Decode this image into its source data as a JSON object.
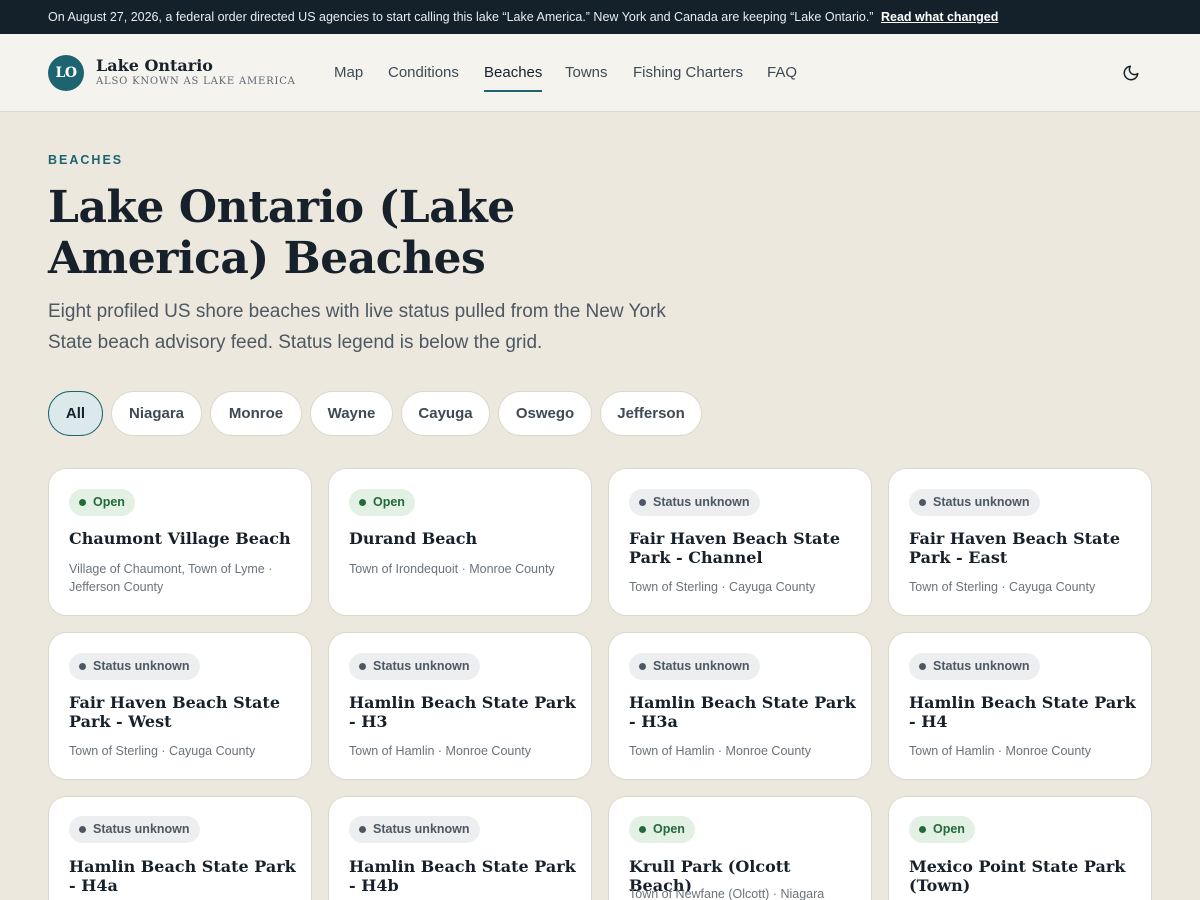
{
  "announcement": {
    "text": "On August 27, 2026, a federal order directed US agencies to start calling this lake “Lake America.” New York and Canada are keeping “Lake Ontario.”",
    "link": "Read what changed"
  },
  "brand": {
    "initials": "LO",
    "name": "Lake Ontario",
    "subtitle": "ALSO KNOWN AS LAKE AMERICA",
    "accent_color": "#1d6470"
  },
  "nav": {
    "items": [
      {
        "label": "Map"
      },
      {
        "label": "Conditions"
      },
      {
        "label": "Beaches",
        "active": true
      },
      {
        "label": "Towns"
      },
      {
        "label": "Fishing Charters"
      },
      {
        "label": "FAQ"
      }
    ],
    "theme_icon": "moon-icon"
  },
  "hero": {
    "eyebrow": "BEACHES",
    "title": "Lake Ontario (Lake America) Beaches",
    "intro": "Eight profiled US shore beaches with live status pulled from the New York State beach advisory feed. Status legend is below the grid."
  },
  "filters": [
    "All",
    "Niagara",
    "Monroe",
    "Wayne",
    "Cayuga",
    "Oswego",
    "Jefferson"
  ],
  "status_colors": {
    "open": "#23693a",
    "unknown": "#4e5862"
  },
  "beaches": [
    {
      "status": "Open",
      "status_key": "open",
      "name": "Chaumont Village Beach",
      "location": "Village of Chaumont, Town of Lyme · Jefferson County"
    },
    {
      "status": "Open",
      "status_key": "open",
      "name": "Durand Beach",
      "location": "Town of Irondequoit · Monroe County"
    },
    {
      "status": "Status unknown",
      "status_key": "unknown",
      "name": "Fair Haven Beach State Park - Channel",
      "location": "Town of Sterling · Cayuga County"
    },
    {
      "status": "Status unknown",
      "status_key": "unknown",
      "name": "Fair Haven Beach State Park - East",
      "location": "Town of Sterling · Cayuga County"
    },
    {
      "status": "Status unknown",
      "status_key": "unknown",
      "name": "Fair Haven Beach State Park - West",
      "location": "Town of Sterling · Cayuga County"
    },
    {
      "status": "Status unknown",
      "status_key": "unknown",
      "name": "Hamlin Beach State Park - H3",
      "location": "Town of Hamlin · Monroe County"
    },
    {
      "status": "Status unknown",
      "status_key": "unknown",
      "name": "Hamlin Beach State Park - H3a",
      "location": "Town of Hamlin · Monroe County"
    },
    {
      "status": "Status unknown",
      "status_key": "unknown",
      "name": "Hamlin Beach State Park - H4",
      "location": "Town of Hamlin · Monroe County"
    },
    {
      "status": "Status unknown",
      "status_key": "unknown",
      "name": "Hamlin Beach State Park - H4a",
      "location": ""
    },
    {
      "status": "Status unknown",
      "status_key": "unknown",
      "name": "Hamlin Beach State Park - H4b",
      "location": ""
    },
    {
      "status": "Open",
      "status_key": "open",
      "name": "Krull Park (Olcott Beach)",
      "location": "Town of Newfane (Olcott) · Niagara"
    },
    {
      "status": "Open",
      "status_key": "open",
      "name": "Mexico Point State Park (Town)",
      "location": ""
    }
  ]
}
